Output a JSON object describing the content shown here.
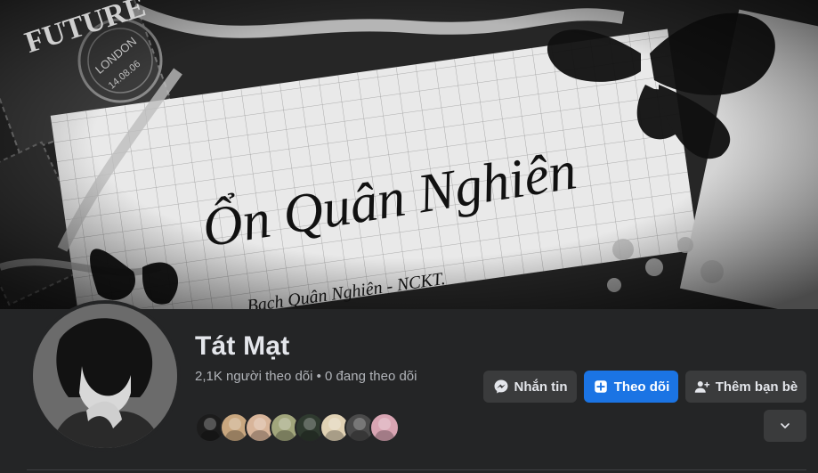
{
  "cover": {
    "handwriting_title": "Ổn Quân Nghiên",
    "handwriting_subtitle": ". Bạch Quân Nghiên - NCKT.",
    "stamp_text_future": "FUTURE",
    "stamp_text_london": "LONDON",
    "stamp_text_date": "14.08.06"
  },
  "profile": {
    "name": "Tát Mạt",
    "stats": "2,1K người theo dõi • 0 đang theo dõi"
  },
  "actions": {
    "message_label": "Nhắn tin",
    "follow_label": "Theo dõi",
    "add_friend_label": "Thêm bạn bè"
  },
  "icons": {
    "message": "messenger-icon",
    "follow": "follow-plus-icon",
    "add_friend": "add-person-icon",
    "more": "chevron-down-icon"
  },
  "colors": {
    "background": "#242526",
    "primary_button": "#1b74e4",
    "secondary_button": "#3a3b3c",
    "text_primary": "#e4e6eb",
    "text_secondary": "#b0b3b8"
  },
  "friend_avatars": [
    {
      "name": "friend-avatar-1",
      "color": "#1c1c1c"
    },
    {
      "name": "friend-avatar-2",
      "color": "#c9a77f"
    },
    {
      "name": "friend-avatar-3",
      "color": "#d8b59a"
    },
    {
      "name": "friend-avatar-4",
      "color": "#a2a67c"
    },
    {
      "name": "friend-avatar-5",
      "color": "#2f3a2f"
    },
    {
      "name": "friend-avatar-6",
      "color": "#e1d2b4"
    },
    {
      "name": "friend-avatar-7",
      "color": "#4a4a4a"
    },
    {
      "name": "friend-avatar-8",
      "color": "#d9a5b3"
    }
  ]
}
